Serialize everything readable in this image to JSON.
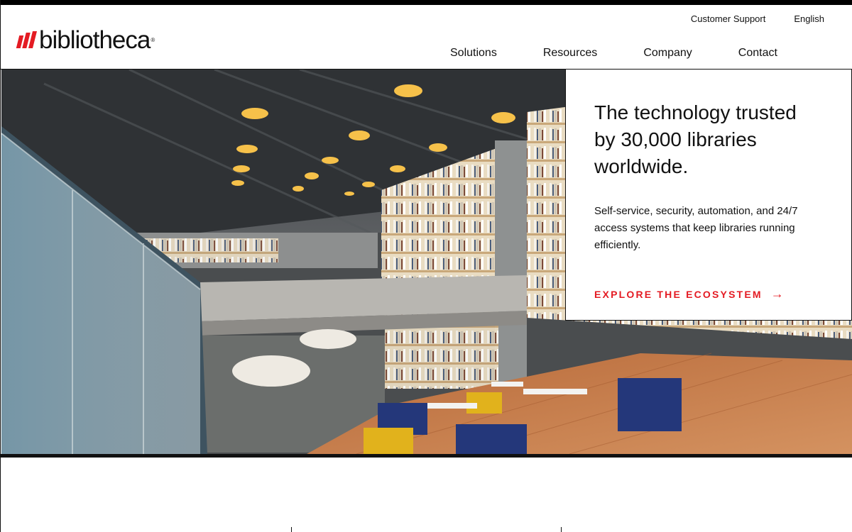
{
  "brand": {
    "name": "bibliotheca",
    "mark": "®",
    "accent": "#e41b23"
  },
  "utility_nav": {
    "support": "Customer Support",
    "language": "English"
  },
  "main_nav": {
    "solutions": "Solutions",
    "resources": "Resources",
    "company": "Company",
    "contact": "Contact"
  },
  "hero": {
    "headline": "The technology trusted by 30,000 libraries worldwide.",
    "body": "Self-service, security, automation, and 24/7 access systems that keep libraries running efficiently.",
    "cta_label": "EXPLORE THE ECOSYSTEM",
    "cta_icon": "arrow-right-icon"
  }
}
